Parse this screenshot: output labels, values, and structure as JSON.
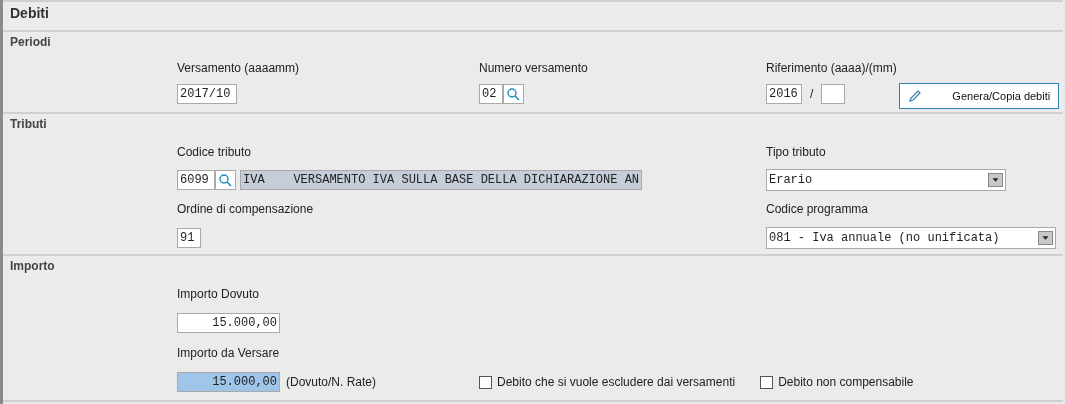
{
  "title": "Debiti",
  "periodi": {
    "title": "Periodi",
    "versamento": {
      "label": "Versamento (aaaamm)",
      "value": "2017/10"
    },
    "numero": {
      "label": "Numero versamento",
      "value": "02"
    },
    "riferimento": {
      "label": "Riferimento (aaaa)/(mm)",
      "year": "2016",
      "separator": "/"
    },
    "button": "Genera/Copia debiti"
  },
  "tributi": {
    "title": "Tributi",
    "codice": {
      "label": "Codice tributo",
      "value": "6099",
      "description": "IVA    VERSAMENTO IVA SULLA BASE DELLA DICHIARAZIONE AN"
    },
    "tipo": {
      "label": "Tipo tributo",
      "value": "Erario"
    },
    "ordine": {
      "label": "Ordine di compensazione",
      "value": "91"
    },
    "programma": {
      "label": "Codice programma",
      "value": "081 - Iva annuale (no unificata)"
    }
  },
  "importo": {
    "title": "Importo",
    "dovuto": {
      "label": "Importo Dovuto",
      "value": "15.000,00"
    },
    "versare": {
      "label": "Importo da Versare",
      "value": "15.000,00",
      "note": "(Dovuto/N. Rate)"
    },
    "checkboxes": [
      {
        "label": "Debito che si vuole escludere dai versamenti",
        "checked": false
      },
      {
        "label": "Debito non compensabile",
        "checked": false
      }
    ]
  }
}
